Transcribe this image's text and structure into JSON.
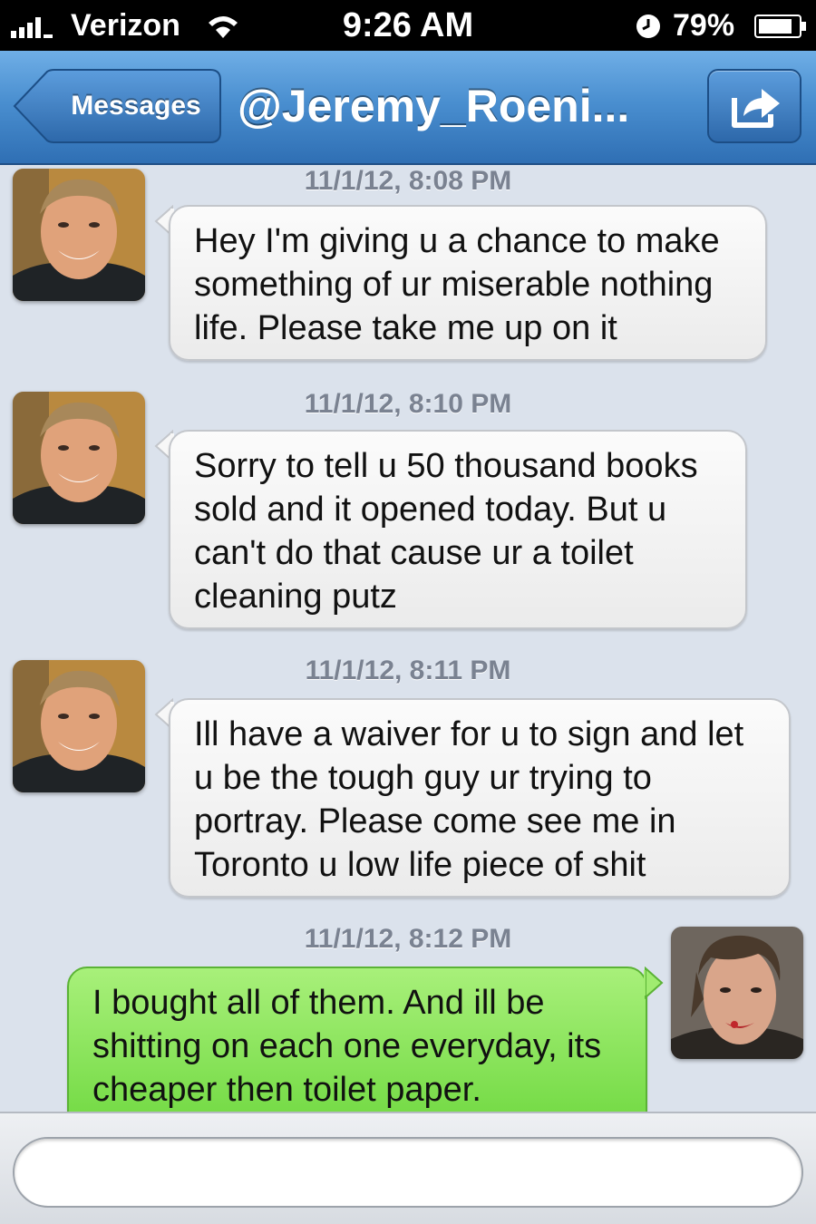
{
  "status_bar": {
    "carrier": "Verizon",
    "time": "9:26 AM",
    "battery_percent": "79%",
    "icons": [
      "signal-icon",
      "wifi-icon",
      "alarm-icon",
      "battery-icon"
    ]
  },
  "nav": {
    "back_label": "Messages",
    "title": "@Jeremy_Roeni...",
    "action_icon": "share-icon"
  },
  "messages": [
    {
      "timestamp": "11/1/12, 8:08 PM",
      "sender": "contact",
      "text": "Hey I'm giving u a chance to make something of ur miserable nothing life.  Please take me up on it"
    },
    {
      "timestamp": "11/1/12, 8:10 PM",
      "sender": "contact",
      "text": "Sorry to tell u 50 thousand books sold and it opened today. But u can't do that cause ur a toilet cleaning putz"
    },
    {
      "timestamp": "11/1/12, 8:11 PM",
      "sender": "contact",
      "text": "Ill have a waiver for u to sign and let u be the tough guy ur trying to portray. Please come see me in Toronto u low life piece of shit"
    },
    {
      "timestamp": "11/1/12, 8:12 PM",
      "sender": "me",
      "text": "I bought all of them. And ill be shitting on each one everyday, its cheaper then toilet paper."
    }
  ],
  "input": {
    "value": "",
    "placeholder": ""
  },
  "colors": {
    "nav_blue": "#4a8fd0",
    "incoming_bubble": "#f3f3f3",
    "outgoing_bubble": "#8ee45c",
    "background": "#dbe2ec"
  }
}
